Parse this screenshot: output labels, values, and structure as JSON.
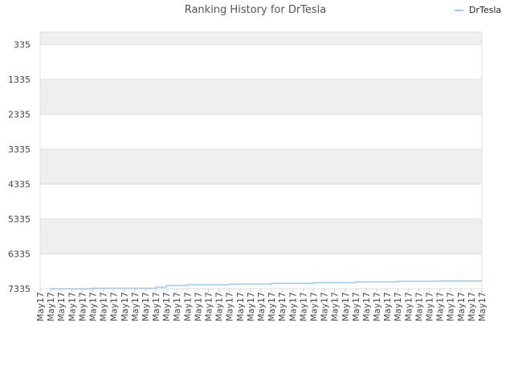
{
  "chart_data": {
    "type": "line",
    "title": "Ranking History for DrTesla",
    "xlabel": "",
    "ylabel": "",
    "y_inverted": true,
    "ylim": [
      7335,
      -20
    ],
    "yticks": [
      335,
      1335,
      2335,
      3335,
      4335,
      5335,
      6335,
      7335
    ],
    "x_tick_labels": [
      "May17",
      "May17",
      "May17",
      "May17",
      "May17",
      "May17",
      "May17",
      "May17",
      "May17",
      "May17",
      "May17",
      "May17",
      "May17",
      "May17",
      "May17",
      "May17",
      "May17",
      "May17",
      "May17",
      "May17",
      "May17",
      "May17",
      "May17",
      "May17",
      "May17",
      "May17",
      "May17",
      "May17",
      "May17",
      "May17",
      "May17",
      "May17",
      "May17",
      "May17",
      "May17",
      "May17",
      "May17",
      "May17",
      "May17",
      "May17",
      "May17",
      "May17",
      "May17"
    ],
    "legend": {
      "position": "top-right"
    },
    "grid": true,
    "series": [
      {
        "name": "DrTesla",
        "color": "#99ccf0",
        "x_index": [
          1,
          2,
          3,
          4,
          5,
          6,
          7,
          8,
          9,
          10,
          11,
          12,
          13,
          14,
          15,
          16,
          17,
          18,
          19,
          20,
          21,
          22,
          23,
          24,
          25,
          26,
          27,
          28,
          29,
          30,
          31,
          32,
          33,
          34,
          35,
          36,
          37,
          38,
          39,
          40,
          41,
          42
        ],
        "values": [
          7335,
          7335,
          7335,
          7335,
          7320,
          7320,
          7320,
          7320,
          7320,
          7320,
          7290,
          7240,
          7240,
          7220,
          7220,
          7220,
          7220,
          7200,
          7200,
          7200,
          7200,
          7180,
          7180,
          7180,
          7180,
          7160,
          7160,
          7160,
          7160,
          7140,
          7140,
          7140,
          7140,
          7120,
          7120,
          7120,
          7120,
          7110,
          7110,
          7110,
          7110,
          7110
        ]
      }
    ]
  }
}
